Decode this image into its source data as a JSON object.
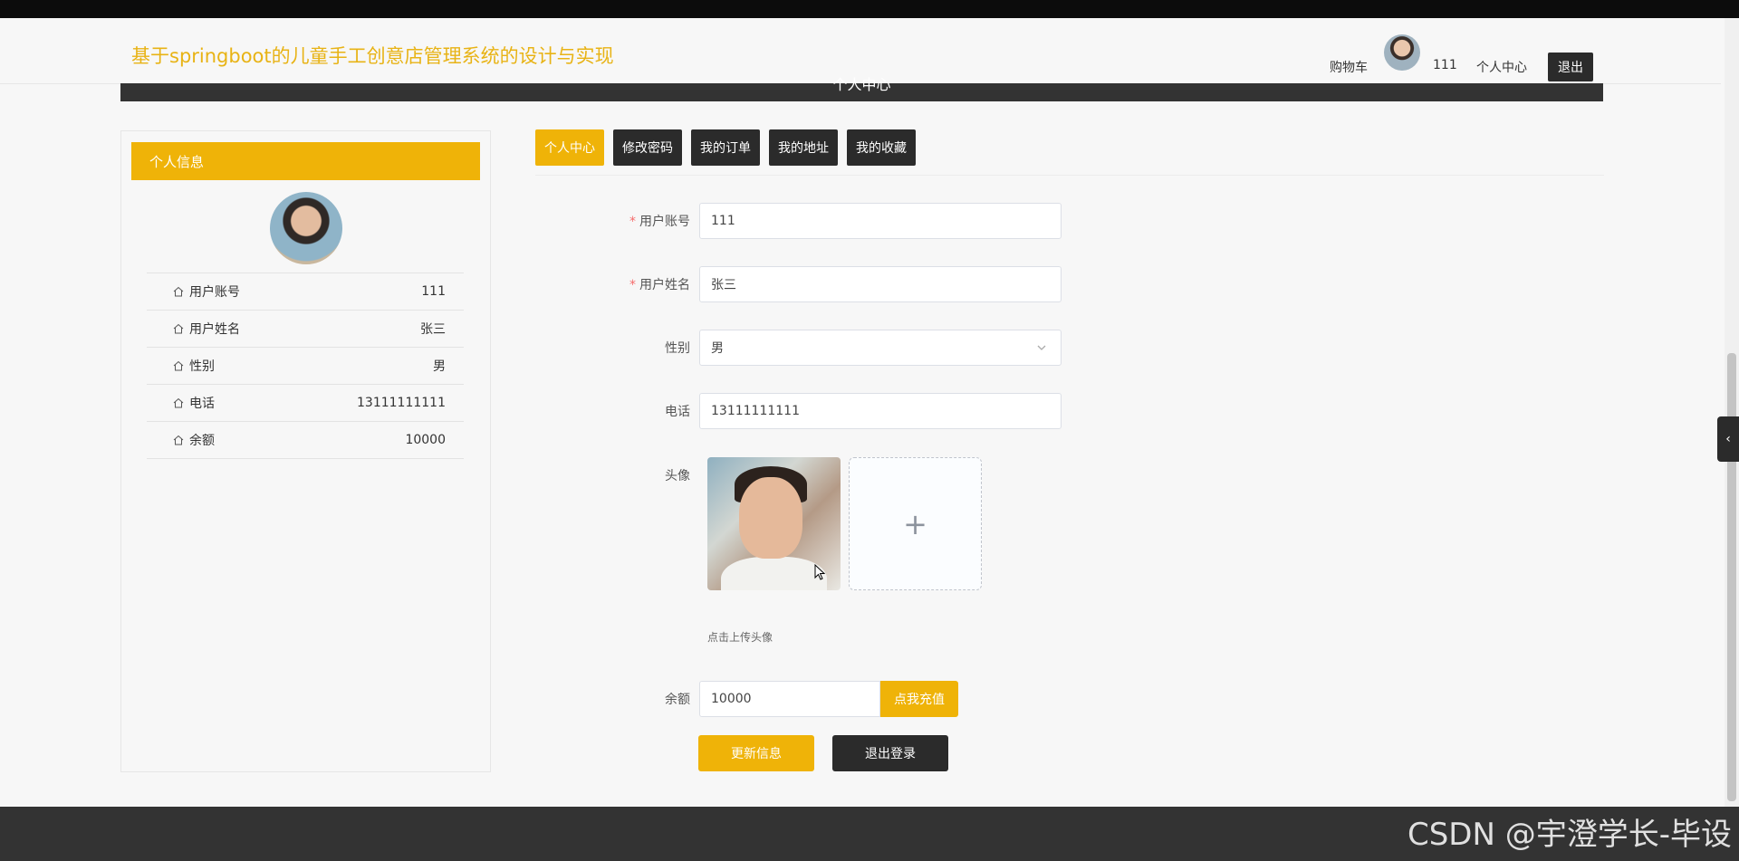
{
  "header": {
    "site_title": "基于springboot的儿童手工创意店管理系统的设计与实现",
    "cart_label": "购物车",
    "username": "111",
    "personal_center_label": "个人中心",
    "logout_label": "退出"
  },
  "banner": {
    "title": "个人中心"
  },
  "profile_panel": {
    "title": "个人信息",
    "rows": [
      {
        "label": "用户账号",
        "value": "111"
      },
      {
        "label": "用户姓名",
        "value": "张三"
      },
      {
        "label": "性别",
        "value": "男"
      },
      {
        "label": "电话",
        "value": "13111111111"
      },
      {
        "label": "余额",
        "value": "10000"
      }
    ]
  },
  "tabs": [
    {
      "label": "个人中心",
      "active": true
    },
    {
      "label": "修改密码",
      "active": false
    },
    {
      "label": "我的订单",
      "active": false
    },
    {
      "label": "我的地址",
      "active": false
    },
    {
      "label": "我的收藏",
      "active": false
    }
  ],
  "form": {
    "account": {
      "label": "用户账号",
      "value": "111",
      "required": true
    },
    "name": {
      "label": "用户姓名",
      "value": "张三",
      "required": true
    },
    "gender": {
      "label": "性别",
      "value": "男"
    },
    "phone": {
      "label": "电话",
      "value": "13111111111"
    },
    "avatar": {
      "label": "头像",
      "hint": "点击上传头像",
      "add_symbol": "+"
    },
    "balance": {
      "label": "余额",
      "value": "10000",
      "recharge_label": "点我充值"
    },
    "update_button": "更新信息",
    "logout_button": "退出登录"
  },
  "watermark": "CSDN @宇澄学长-毕设",
  "colors": {
    "accent": "#efb308",
    "dark": "#2b2b2b",
    "title": "#e8b315"
  }
}
